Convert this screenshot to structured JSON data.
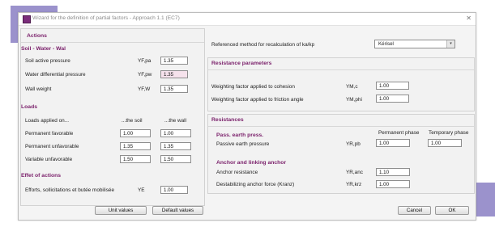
{
  "window": {
    "title": "Wizard for the definition of partial factors - Approach 1.1 (EC7)",
    "close_glyph": "✕"
  },
  "left": {
    "actions_header": "Actions",
    "soil_water_wall": {
      "title": "Soil - Water - Wal",
      "rows": [
        {
          "label": "Soil active pressure",
          "symbol": "YF,pa",
          "value": "1.35"
        },
        {
          "label": "Water differential pressure",
          "symbol": "YF,pw",
          "value": "1.35"
        },
        {
          "label": "Wall weight",
          "symbol": "YF,W",
          "value": "1.35"
        }
      ]
    },
    "loads": {
      "title": "Loads",
      "applied_label": "Loads applied on...",
      "col_soil": "...the soil",
      "col_wall": "...the wall",
      "rows": [
        {
          "label": "Permanent favorable",
          "soil": "1.00",
          "wall": "1.00"
        },
        {
          "label": "Permanent unfavorable",
          "soil": "1.35",
          "wall": "1.35"
        },
        {
          "label": "Variable unfavorable",
          "soil": "1.50",
          "wall": "1.50"
        }
      ]
    },
    "effect": {
      "title": "Effet of actions",
      "label": "Efforts, sollicitations et butée mobilisée",
      "symbol": "YE",
      "value": "1.00"
    },
    "buttons": {
      "unit_values": "Unit values",
      "default_values": "Default values"
    }
  },
  "right": {
    "ref_method": {
      "label": "Referenced method for recalculation of ka/kp",
      "value": "Kérisel",
      "arrow": "▾"
    },
    "resistance_params": {
      "title": "Resistance parameters",
      "rows": [
        {
          "label": "Weighting factor applied to cohesion",
          "symbol": "YM,c",
          "value": "1.00"
        },
        {
          "label": "Weighting factor applied to friction angle",
          "symbol": "YM,phi",
          "value": "1.00"
        }
      ]
    },
    "resistances": {
      "title": "Resistances",
      "pass_title": "Pass. earth press.",
      "col_permanent": "Permanent phase",
      "col_temporary": "Temporary phase",
      "passive": {
        "label": "Passive earth pressure",
        "symbol": "YR,pb",
        "permanent": "1.00",
        "temporary": "1.00"
      },
      "anchor_title": "Anchor and linking anchor",
      "anchor_rows": [
        {
          "label": "Anchor resistance",
          "symbol": "YR,anc",
          "value": "1.10"
        },
        {
          "label": "Destabilizing anchor force (Kranz)",
          "symbol": "YR,krz",
          "value": "1.00"
        }
      ]
    },
    "buttons": {
      "cancel": "Cancel",
      "ok": "OK"
    }
  }
}
